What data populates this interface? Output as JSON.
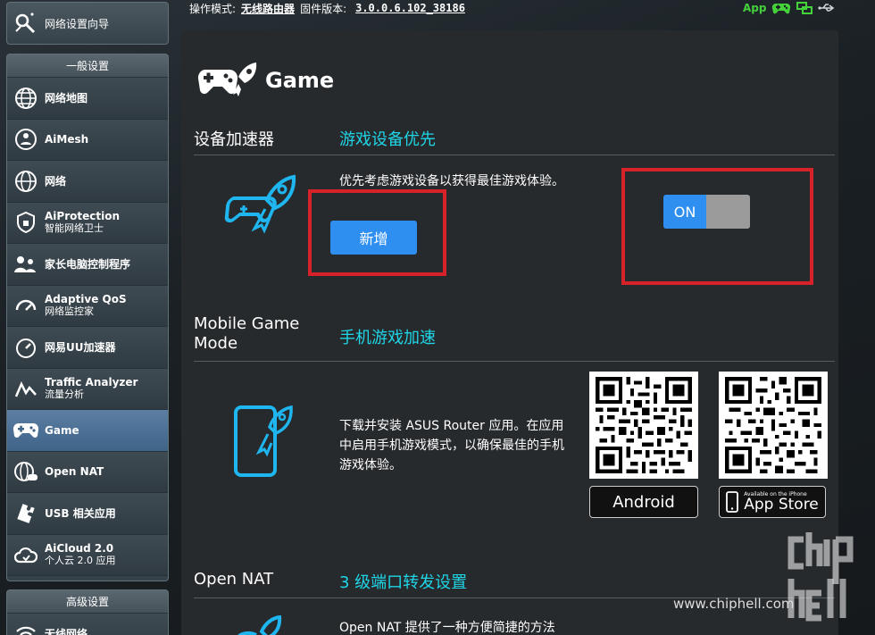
{
  "topbar": {
    "mode_label": "操作模式:",
    "mode_value": "无线路由器",
    "firmware_label": "固件版本:",
    "firmware_value": "3.0.0.6.102_38186",
    "app_label": "App"
  },
  "sidebar": {
    "wizard_label": "网络设置向导",
    "general_header": "一般设置",
    "items": [
      {
        "label": "网络地图",
        "sub": ""
      },
      {
        "label": "AiMesh",
        "sub": ""
      },
      {
        "label": "网络",
        "sub": ""
      },
      {
        "label": "AiProtection",
        "sub": "智能网络卫士"
      },
      {
        "label": "家长电脑控制程序",
        "sub": ""
      },
      {
        "label": "Adaptive QoS",
        "sub": "网络监控家"
      },
      {
        "label": "网易UU加速器",
        "sub": ""
      },
      {
        "label": "Traffic Analyzer",
        "sub": "流量分析"
      },
      {
        "label": "Game",
        "sub": ""
      },
      {
        "label": "Open NAT",
        "sub": ""
      },
      {
        "label": "USB 相关应用",
        "sub": ""
      },
      {
        "label": "AiCloud 2.0",
        "sub": "个人云 2.0 应用"
      }
    ],
    "advanced_header": "高级设置",
    "advanced_first": "无线网络"
  },
  "main": {
    "title": "Game",
    "accelerator": {
      "label": "设备加速器",
      "value": "游戏设备优先",
      "description": "优先考虑游戏设备以获得最佳游戏体验。",
      "add_button": "新增",
      "toggle_on": "ON"
    },
    "mobile": {
      "label_line1": "Mobile Game",
      "label_line2": "Mode",
      "value": "手机游戏加速",
      "description": "下载并安装 ASUS Router 应用。在应用中启用手机游戏模式，以确保最佳的手机游戏体验。",
      "android_label": "Android",
      "appstore_small": "Available on the iPhone",
      "appstore_label": "App Store"
    },
    "opennat": {
      "label": "Open NAT",
      "value": "3 级端口转发设置",
      "description": "Open NAT 提供了一种方便简捷的方法"
    }
  },
  "watermark": {
    "url": "www.chiphell.com",
    "logo": "chip hell"
  },
  "colors": {
    "accent": "#1fd5e6",
    "button": "#2f8ff0",
    "highlight_box": "#d8222a",
    "app_green": "#44d13a"
  }
}
